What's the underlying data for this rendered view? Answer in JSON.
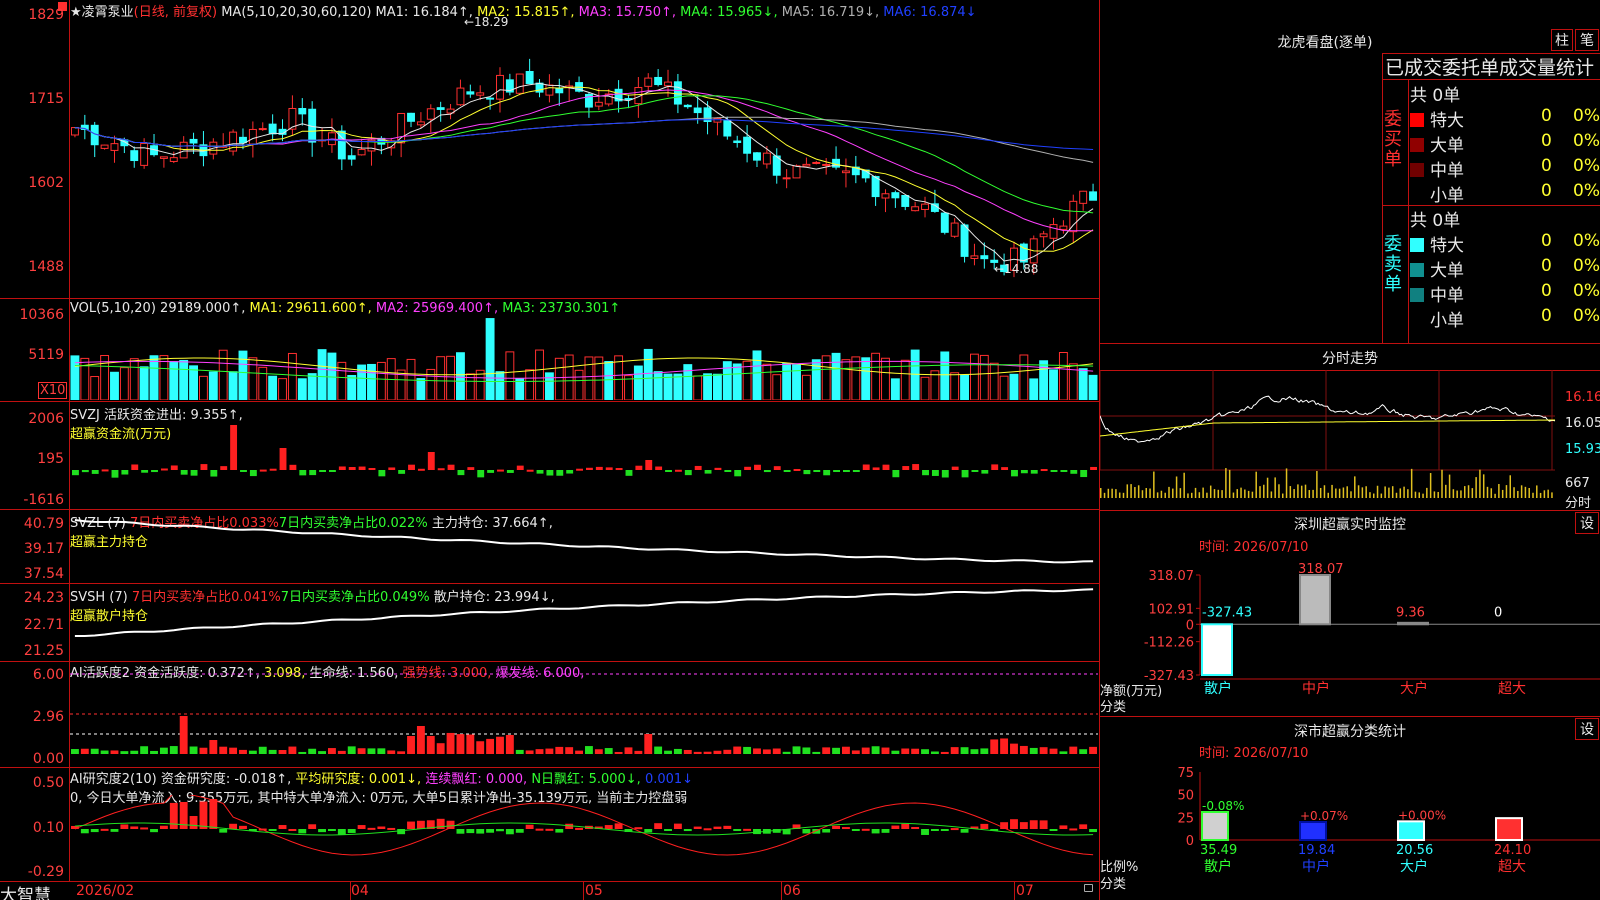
{
  "stock": {
    "name": "★凌霄泵业",
    "mode": "(日线, 前复权)",
    "ma_prefix": "MA(5,10,20,30,60,120)",
    "ma1": "MA1: 16.184↑,",
    "ma2": "MA2: 15.815↑,",
    "ma3": "MA3: 15.750↑,",
    "ma4": "MA4: 15.965↓,",
    "ma5": "MA5: 16.719↓,",
    "ma6": "MA6: 16.874↓",
    "high_label": "←18.29",
    "low_label": "←14.88"
  },
  "price_axis": [
    "1829",
    "1715",
    "1602",
    "1488"
  ],
  "vol": {
    "prefix": "VOL(5,10,20)",
    "val": "29189.000↑,",
    "ma1": "MA1: 29611.600↑,",
    "ma2": "MA2: 25969.400↑,",
    "ma3": "MA3: 23730.301↑",
    "axis": [
      "10366",
      "5119"
    ],
    "unit": "X10"
  },
  "svzj": {
    "line1": "SVZJ  活跃资金进出: 9.355↑,",
    "line2": "超赢资金流(万元)",
    "axis": [
      "2006",
      "195",
      "-1616"
    ]
  },
  "svzl": {
    "prefix": "SVZL (7)",
    "a": "7日内买卖净占比0.033%",
    "b": "7日内买卖净占比0.022%",
    "c": "主力持仓: 37.664↑,",
    "line2": "超赢主力持仓",
    "axis": [
      "40.79",
      "39.17",
      "37.54"
    ]
  },
  "svsh": {
    "prefix": "SVSH (7)",
    "a": "7日内买卖净占比0.041%",
    "b": "7日内买卖净占比0.049%",
    "c": "散户持仓: 23.994↓,",
    "line2": "超赢散户持仓",
    "axis": [
      "24.23",
      "22.71",
      "21.25"
    ]
  },
  "ai1": {
    "a": "AI活跃度2 资金活跃度: 0.372↑,",
    "b": "3.098,",
    "c": "生命线: 1.560,",
    "d": "强势线: 3.000,",
    "e": "爆发线: 6.000,",
    "axis": [
      "6.00",
      "2.96",
      "0.00"
    ]
  },
  "ai2": {
    "a": "AI研究度2(10) 资金研究度: -0.018↑,",
    "b": "平均研究度: 0.001↓,",
    "c": "连续飘红: 0.000,",
    "d": "N日飘红: 5.000↓,",
    "e": "0.001↓",
    "line2": "0, 今日大单净流入: 9.355万元, 其中特大单净流入: 0万元, 大单5日累计净出-35.139万元, 当前主力控盘弱",
    "axis": [
      "0.50",
      "0.10",
      "-0.29"
    ]
  },
  "date_axis": [
    "2026/02",
    "04",
    "05",
    "06",
    "07"
  ],
  "brand": "大智慧",
  "lhkp": {
    "title": "龙虎看盘(逐单)",
    "btn1": "柱",
    "btn2": "笔",
    "tabs": "已成交委托单成交量统计",
    "buy_label": "委买单",
    "sell_label": "委卖单",
    "buy_total": "共 0单",
    "sell_total": "共 0单",
    "buy_rows": [
      {
        "name": "特大",
        "n": "0",
        "p": "0%",
        "color": "#ff0000"
      },
      {
        "name": "大单",
        "n": "0",
        "p": "0%",
        "color": "#900000"
      },
      {
        "name": "中单",
        "n": "0",
        "p": "0%",
        "color": "#700000"
      },
      {
        "name": "小单",
        "n": "0",
        "p": "0%",
        "color": "#000000"
      }
    ],
    "sell_rows": [
      {
        "name": "特大",
        "n": "0",
        "p": "0%",
        "color": "#30ffff"
      },
      {
        "name": "大单",
        "n": "0",
        "p": "0%",
        "color": "#109090"
      },
      {
        "name": "中单",
        "n": "0",
        "p": "0%",
        "color": "#108080"
      },
      {
        "name": "小单",
        "n": "0",
        "p": "0%",
        "color": "#000000"
      }
    ]
  },
  "intraday": {
    "title": "分时走势",
    "p_hi": "16.16",
    "p_mid": "16.05",
    "p_lo": "15.93",
    "vol": "667",
    "vol_label": "分时"
  },
  "sz_monitor": {
    "title": "深圳超赢实时监控",
    "btn": "设",
    "time": "时间: 2026/07/10",
    "axis": [
      "318.07",
      "102.91",
      "0",
      "-112.26",
      "-327.43"
    ],
    "ylabel1": "净额(万元)",
    "ylabel2": "分类",
    "bars": [
      {
        "cat": "散户",
        "val": -327.43,
        "label": "-327.43"
      },
      {
        "cat": "中户",
        "val": 318.07,
        "label": "318.07"
      },
      {
        "cat": "大户",
        "val": 9.36,
        "label": "9.36"
      },
      {
        "cat": "超大",
        "val": 0,
        "label": "0"
      }
    ]
  },
  "sz_stats": {
    "title": "深市超赢分类统计",
    "btn": "设",
    "time": "时间: 2026/07/10",
    "axis": [
      "75",
      "50",
      "25",
      "0"
    ],
    "ylabel1": "比例%",
    "ylabel2": "分类",
    "bars": [
      {
        "cat": "散户",
        "val": 35.49,
        "label": "35.49",
        "chg": "-0.08%"
      },
      {
        "cat": "中户",
        "val": 19.84,
        "label": "19.84",
        "chg": "+0.07%"
      },
      {
        "cat": "大户",
        "val": 20.56,
        "label": "20.56",
        "chg": "+0.00%"
      },
      {
        "cat": "超大",
        "val": 24.1,
        "label": "24.10",
        "chg": ""
      }
    ]
  }
}
